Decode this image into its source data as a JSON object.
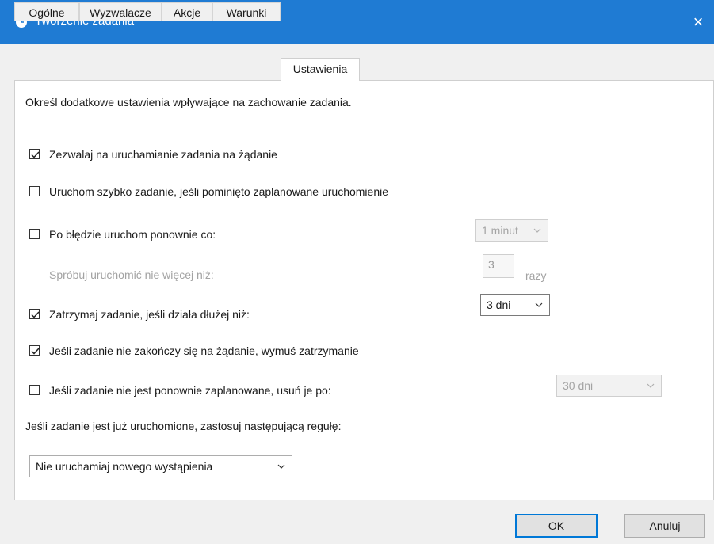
{
  "window": {
    "title": "Tworzenie zadania",
    "close_icon": "×",
    "title_bar_color": "#1f7bd3"
  },
  "tabs": [
    {
      "label": "Ogólne",
      "active": false
    },
    {
      "label": "Wyzwalacze",
      "active": false
    },
    {
      "label": "Akcje",
      "active": false
    },
    {
      "label": "Warunki",
      "active": false
    },
    {
      "label": "Ustawienia",
      "active": true
    }
  ],
  "settings": {
    "description": "Określ dodatkowe ustawienia wpływające na zachowanie zadania.",
    "allow_on_demand": {
      "label": "Zezwalaj na uruchamianie zadania na żądanie",
      "checked": true
    },
    "run_asap": {
      "label": "Uruchom szybko zadanie, jeśli pominięto zaplanowane uruchomienie",
      "checked": false
    },
    "restart_on_fail": {
      "label": "Po błędzie uruchom ponownie co:",
      "checked": false,
      "interval_value": "1 minut"
    },
    "retry_count": {
      "label": "Spróbuj uruchomić nie więcej niż:",
      "value": "3",
      "unit": "razy"
    },
    "stop_if_longer": {
      "label": "Zatrzymaj zadanie, jeśli działa dłużej niż:",
      "checked": true,
      "value": "3 dni"
    },
    "force_stop": {
      "label": "Jeśli zadanie nie zakończy się na żądanie, wymuś zatrzymanie",
      "checked": true
    },
    "delete_if_not_scheduled": {
      "label": "Jeśli zadanie nie jest ponownie zaplanowane, usuń je po:",
      "checked": false,
      "value": "30 dni"
    },
    "rule_label": "Jeśli zadanie jest już uruchomione, zastosuj następującą regułę:",
    "rule_value": "Nie uruchamiaj nowego wystąpienia"
  },
  "buttons": {
    "ok": "OK",
    "cancel": "Anuluj"
  }
}
